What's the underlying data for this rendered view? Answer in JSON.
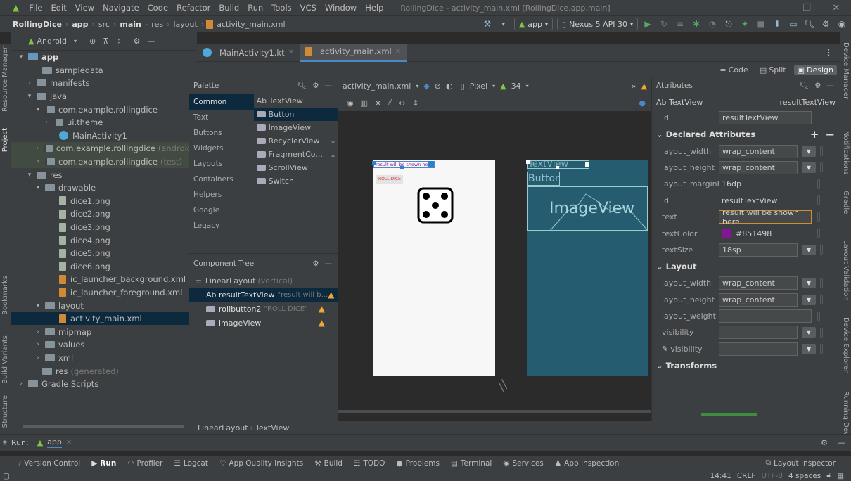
{
  "menubar": {
    "items": [
      "File",
      "Edit",
      "View",
      "Navigate",
      "Code",
      "Refactor",
      "Build",
      "Run",
      "Tools",
      "VCS",
      "Window",
      "Help"
    ],
    "title": "RollingDice - activity_main.xml [RollingDice.app.main]"
  },
  "navbar": {
    "breadcrumbs": [
      "RollingDice",
      "app",
      "src",
      "main",
      "res",
      "layout",
      "activity_main.xml"
    ],
    "config": "app",
    "device": "Nexus 5 API 30"
  },
  "project": {
    "view_mode": "Android",
    "tree": [
      {
        "label": "app",
        "indent": 0,
        "arrow": "▾",
        "kind": "folder-blue",
        "bold": true
      },
      {
        "label": "sampledata",
        "indent": 2,
        "arrow": "",
        "kind": "folder"
      },
      {
        "label": "manifests",
        "indent": 1,
        "arrow": "›",
        "kind": "folder"
      },
      {
        "label": "java",
        "indent": 1,
        "arrow": "▾",
        "kind": "folder"
      },
      {
        "label": "com.example.rollingdice",
        "indent": 2,
        "arrow": "▾",
        "kind": "pkg"
      },
      {
        "label": "ui.theme",
        "indent": 3,
        "arrow": "›",
        "kind": "pkg"
      },
      {
        "label": "MainActivity1",
        "indent": 4,
        "arrow": "",
        "kind": "kt"
      },
      {
        "label": "com.example.rollingdice",
        "suffix": "(androidT",
        "indent": 2,
        "arrow": "›",
        "kind": "pkg",
        "hl": true
      },
      {
        "label": "com.example.rollingdice",
        "suffix": "(test)",
        "indent": 2,
        "arrow": "›",
        "kind": "pkg",
        "hl": true
      },
      {
        "label": "res",
        "indent": 1,
        "arrow": "▾",
        "kind": "folder"
      },
      {
        "label": "drawable",
        "indent": 2,
        "arrow": "▾",
        "kind": "folder"
      },
      {
        "label": "dice1.png",
        "indent": 4,
        "arrow": "",
        "kind": "file"
      },
      {
        "label": "dice2.png",
        "indent": 4,
        "arrow": "",
        "kind": "file"
      },
      {
        "label": "dice3.png",
        "indent": 4,
        "arrow": "",
        "kind": "file"
      },
      {
        "label": "dice4.png",
        "indent": 4,
        "arrow": "",
        "kind": "file"
      },
      {
        "label": "dice5.png",
        "indent": 4,
        "arrow": "",
        "kind": "file"
      },
      {
        "label": "dice6.png",
        "indent": 4,
        "arrow": "",
        "kind": "file"
      },
      {
        "label": "ic_launcher_background.xml",
        "indent": 4,
        "arrow": "",
        "kind": "xml"
      },
      {
        "label": "ic_launcher_foreground.xml",
        "indent": 4,
        "arrow": "",
        "kind": "xml"
      },
      {
        "label": "layout",
        "indent": 2,
        "arrow": "▾",
        "kind": "folder"
      },
      {
        "label": "activity_main.xml",
        "indent": 4,
        "arrow": "",
        "kind": "xml",
        "selected": true
      },
      {
        "label": "mipmap",
        "indent": 2,
        "arrow": "›",
        "kind": "folder"
      },
      {
        "label": "values",
        "indent": 2,
        "arrow": "›",
        "kind": "folder"
      },
      {
        "label": "xml",
        "indent": 2,
        "arrow": "›",
        "kind": "folder"
      },
      {
        "label": "res",
        "suffix": "(generated)",
        "indent": 2,
        "arrow": "",
        "kind": "folder"
      },
      {
        "label": "Gradle Scripts",
        "indent": 0,
        "arrow": "›",
        "kind": "gradle"
      }
    ]
  },
  "tabs": [
    {
      "label": "MainActivity1.kt",
      "active": false
    },
    {
      "label": "activity_main.xml",
      "active": true
    }
  ],
  "view_modes": {
    "code": "Code",
    "split": "Split",
    "design": "Design"
  },
  "palette": {
    "title": "Palette",
    "categories": [
      "Common",
      "Text",
      "Buttons",
      "Widgets",
      "Layouts",
      "Containers",
      "Helpers",
      "Google",
      "Legacy"
    ],
    "items": [
      "Ab TextView",
      "Button",
      "ImageView",
      "RecyclerView",
      "FragmentCo...",
      "ScrollView",
      "Switch"
    ]
  },
  "component_tree": {
    "title": "Component Tree",
    "root": "LinearLayout",
    "root_suffix": "(vertical)",
    "children": [
      {
        "label": "Ab resultTextView",
        "detail": "\"result will b...",
        "selected": true
      },
      {
        "label": "rollbutton2",
        "detail": "\"ROLL DICE\"",
        "selected": false
      },
      {
        "label": "imageView",
        "detail": "",
        "selected": false
      }
    ]
  },
  "canvas_toolbar": {
    "file": "activity_main.xml",
    "device": "Pixel",
    "api": "34"
  },
  "preview": {
    "result_text": "result will be shown here",
    "button_text": "ROLL DICE",
    "bp_textview": "TextView",
    "bp_button": "Button",
    "bp_imageview": "ImageView"
  },
  "attributes": {
    "title": "Attributes",
    "widget_type": "Ab TextView",
    "widget_id": "resultTextView",
    "id_label": "id",
    "id_value": "resultTextView",
    "declared_title": "Declared Attributes",
    "declared": [
      {
        "name": "layout_width",
        "value": "wrap_content",
        "drop": true
      },
      {
        "name": "layout_height",
        "value": "wrap_content",
        "drop": true
      },
      {
        "name": "layout_marginBott...",
        "value": "16dp",
        "drop": false
      },
      {
        "name": "id",
        "value": "resultTextView",
        "drop": false
      },
      {
        "name": "text",
        "value": "result will be shown here",
        "drop": false,
        "focus": true
      },
      {
        "name": "textColor",
        "value": "#851498",
        "drop": false,
        "color": "#851498"
      },
      {
        "name": "textSize",
        "value": "18sp",
        "drop": true
      }
    ],
    "layout_title": "Layout",
    "layout": [
      {
        "name": "layout_width",
        "value": "wrap_content",
        "drop": true
      },
      {
        "name": "layout_height",
        "value": "wrap_content",
        "drop": true
      },
      {
        "name": "layout_weight",
        "value": "",
        "drop": false
      },
      {
        "name": "visibility",
        "value": "",
        "drop": true
      },
      {
        "name": "visibility",
        "value": "",
        "drop": true,
        "tool": true
      }
    ],
    "transforms_title": "Transforms"
  },
  "breadbar": [
    "LinearLayout",
    "TextView"
  ],
  "run": {
    "label": "Run:",
    "config": "app"
  },
  "bottom_tools": [
    "Version Control",
    "Run",
    "Profiler",
    "Logcat",
    "App Quality Insights",
    "Build",
    "TODO",
    "Problems",
    "Terminal",
    "Services",
    "App Inspection"
  ],
  "layout_inspector": "Layout Inspector",
  "status": {
    "time": "14:41",
    "eol": "CRLF",
    "encoding": "UTF-8",
    "indent": "4 spaces"
  },
  "left_stripe": [
    "Resource Manager",
    "Project",
    "Bookmarks",
    "Build Variants",
    "Structure"
  ],
  "right_stripe": [
    "Device Manager",
    "Notifications",
    "Gradle",
    "Layout Validation",
    "Device Explorer",
    "Running Devices"
  ],
  "colors": {
    "accent": "#4a88c7",
    "warning": "#f0a732",
    "selection": "#0d293e",
    "text_color": "#851498",
    "blueprint": "#255c6f"
  }
}
